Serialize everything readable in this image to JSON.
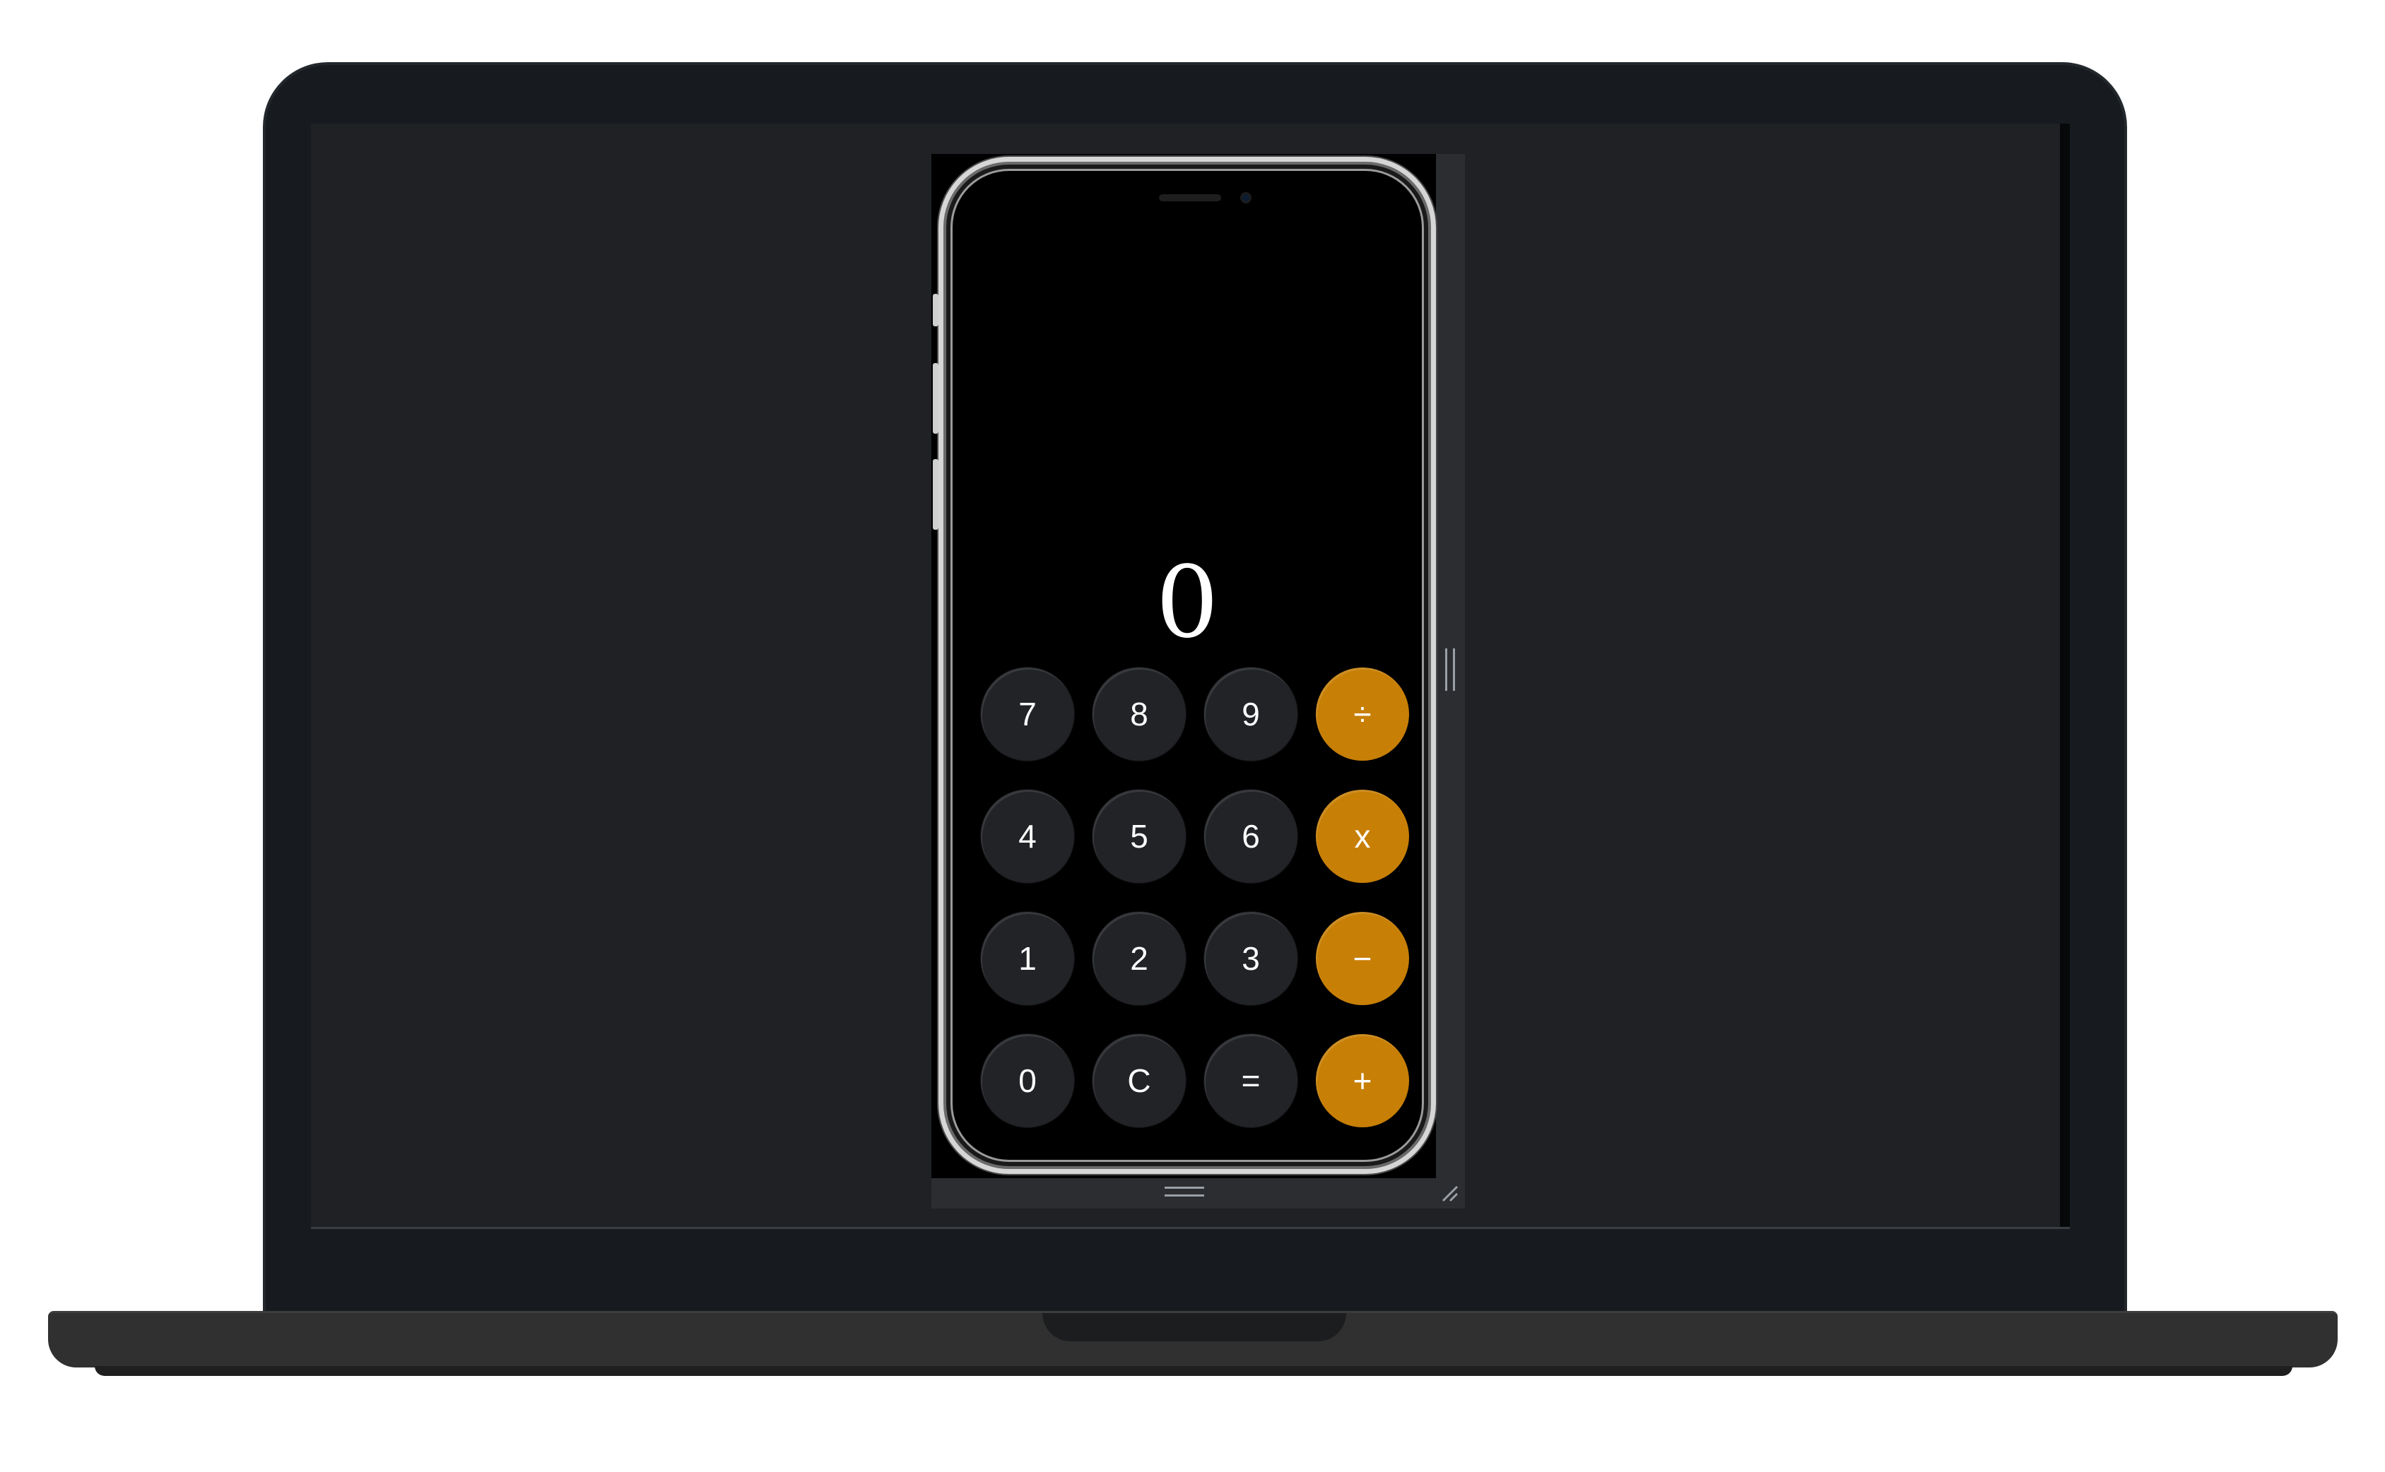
{
  "calculator": {
    "display_value": "0",
    "keys": [
      {
        "label": "7",
        "type": "digit"
      },
      {
        "label": "8",
        "type": "digit"
      },
      {
        "label": "9",
        "type": "digit"
      },
      {
        "label": "÷",
        "type": "operator"
      },
      {
        "label": "4",
        "type": "digit"
      },
      {
        "label": "5",
        "type": "digit"
      },
      {
        "label": "6",
        "type": "digit"
      },
      {
        "label": "x",
        "type": "operator"
      },
      {
        "label": "1",
        "type": "digit"
      },
      {
        "label": "2",
        "type": "digit"
      },
      {
        "label": "3",
        "type": "digit"
      },
      {
        "label": "−",
        "type": "operator"
      },
      {
        "label": "0",
        "type": "digit"
      },
      {
        "label": "C",
        "type": "clear"
      },
      {
        "label": "=",
        "type": "equals"
      },
      {
        "label": "+",
        "type": "operator"
      }
    ]
  },
  "colors": {
    "digit_key": "#212327",
    "operator_key": "#c77f06",
    "screen_background": "#202124",
    "phone_screen": "#000000"
  }
}
